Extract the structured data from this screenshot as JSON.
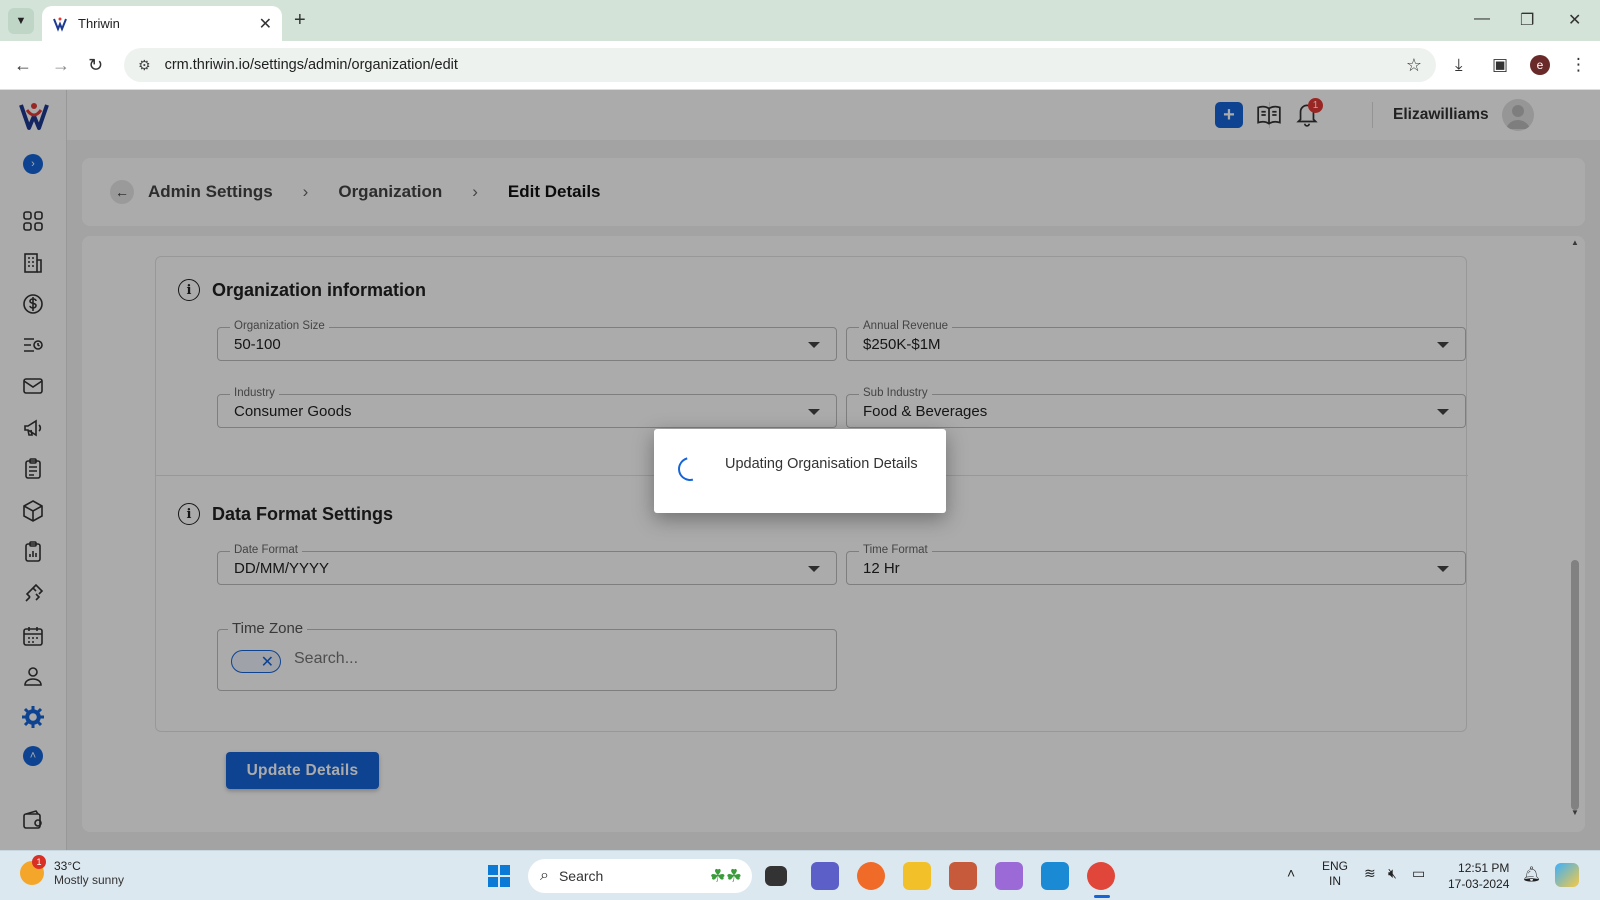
{
  "browser": {
    "tab_title": "Thriwin",
    "url": "crm.thriwin.io/settings/admin/organization/edit",
    "profile_initial": "e"
  },
  "header": {
    "notification_count": "1",
    "username": "Elizawilliams"
  },
  "breadcrumb": {
    "items": [
      "Admin Settings",
      "Organization"
    ],
    "current": "Edit Details"
  },
  "org_section": {
    "title": "Organization information",
    "fields": {
      "org_size": {
        "label": "Organization Size",
        "value": "50-100"
      },
      "annual_revenue": {
        "label": "Annual Revenue",
        "value": "$250K-$1M"
      },
      "industry": {
        "label": "Industry",
        "value": "Consumer Goods"
      },
      "sub_industry": {
        "label": "Sub Industry",
        "value": "Food & Beverages"
      }
    }
  },
  "format_section": {
    "title": "Data Format Settings",
    "fields": {
      "date_format": {
        "label": "Date Format",
        "value": "DD/MM/YYYY"
      },
      "time_format": {
        "label": "Time Format",
        "value": "12 Hr"
      }
    },
    "time_zone": {
      "label": "Time Zone",
      "placeholder": "Search..."
    }
  },
  "update_button": "Update Details",
  "modal": {
    "message": "Updating Organisation Details"
  },
  "taskbar": {
    "weather_temp": "33°C",
    "weather_desc": "Mostly sunny",
    "weather_badge": "1",
    "search_label": "Search",
    "lang_1": "ENG",
    "lang_2": "IN",
    "time": "12:51 PM",
    "date": "17-03-2024"
  },
  "colors": {
    "primary": "#1565d8",
    "badge": "#e53935"
  }
}
